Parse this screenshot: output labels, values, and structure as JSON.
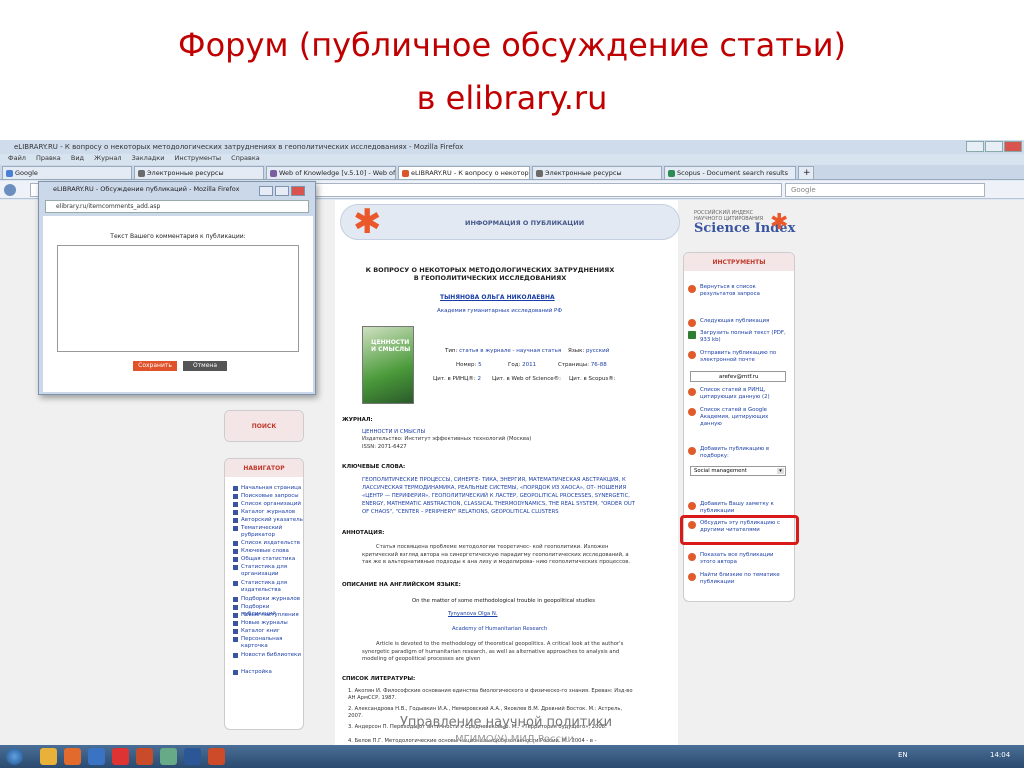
{
  "slide": {
    "title_line1": "Форум (публичное обсуждение статьи)",
    "title_line2": "в elibrary.ru",
    "footer_line1": "Управление научной политики",
    "footer_line2": "МГИМО(У) МИД России"
  },
  "browser": {
    "window_title": "eLIBRARY.RU - К вопросу о некоторых методологических затруднениях в геополитических исследованиях - Mozilla Firefox",
    "menu": [
      "Файл",
      "Правка",
      "Вид",
      "Журнал",
      "Закладки",
      "Инструменты",
      "Справка"
    ],
    "tabs": [
      {
        "label": "Google",
        "color": "#4a7fd6"
      },
      {
        "label": "Электронные ресурсы",
        "color": "#6a6a6a"
      },
      {
        "label": "Web of Knowledge [v.5.10] - Web of ...",
        "color": "#7a5fa0"
      },
      {
        "label": "eLIBRARY.RU - К вопросу о некотор...",
        "color": "#d9532b"
      },
      {
        "label": "Электронные ресурсы",
        "color": "#6a6a6a"
      },
      {
        "label": "Scopus - Document search results",
        "color": "#2e8b57"
      }
    ],
    "search_placeholder": "Google"
  },
  "popup": {
    "title": "eLIBRARY.RU - Обсуждение публикаций - Mozilla Firefox",
    "url": "elibrary.ru/itemcomments_add.asp",
    "label": "Текст Вашего комментария к публикации:",
    "save": "Сохранить",
    "cancel": "Отмена"
  },
  "article": {
    "header": "ИНФОРМАЦИЯ О ПУБЛИКАЦИИ",
    "title": "К ВОПРОСУ О НЕКОТОРЫХ МЕТОДОЛОГИЧЕСКИХ ЗАТРУДНЕНИЯХ В ГЕОПОЛИТИЧЕСКИХ ИССЛЕДОВАНИЯХ",
    "author": "ТЫНЯНОВА ОЛЬГА НИКОЛАЕВНА",
    "affiliation": "Академия гуманитарных исследований РФ",
    "cover_title": "ЦЕННОСТИ И СМЫСЛЫ",
    "type_label": "Тип:",
    "type_value": "статья в журнале - научная статья",
    "lang_label": "Язык:",
    "lang_value": "русский",
    "number_label": "Номер:",
    "number_value": "5",
    "year_label": "Год:",
    "year_value": "2011",
    "pages_label": "Страницы:",
    "pages_value": "76-88",
    "rinc_label": "Цит. в РИНЦ®:",
    "rinc_value": "2",
    "wos_label": "Цит. в Web of Science®:",
    "scopus_label": "Цит. в Scopus®:",
    "journal_section": "ЖУРНАЛ:",
    "journal_name": "ЦЕННОСТИ И СМЫСЛЫ",
    "publisher": "Издательство: Институт эффективных технологий (Москва)",
    "issn": "ISSN: 2071-6427",
    "keywords_section": "КЛЮЧЕВЫЕ СЛОВА:",
    "keywords": "ГЕОПОЛИТИЧЕСКИЕ ПРОЦЕССЫ, СИНЕРГЕ- ТИКА, ЭНЕРГИЯ, МАТЕМАТИЧЕСКАЯ АБСТРАКЦИЯ, К ЛАССИЧЕСКАЯ ТЕРМОДИНАМИКА, РЕАЛЬНЫЕ СИСТЕМЫ, «ПОРЯДОК ИЗ ХАОСА», ОТ- НОШЕНИЯ «ЦЕНТР — ПЕРИФЕРИЯ», ГЕОПОЛИТИЧЕСКИЙ К ЛАСТЕР, GEOPOLITICAL PROCESSES, SYNERGETIC, ENERGY, MATHEMATIC ABSTRACTION, CLASSICAL THERMODYNAMICS, THE REAL SYSTEM, \"ORDER OUT OF CHAOS\", \"CENTER – PERIPHERY\" RELATIONS, GEOPOLITICAL CLUSTERS",
    "annotation_section": "АННОТАЦИЯ:",
    "annotation": "Статья посвящена проблеме методологии теоретичес- кой геополитики. Изложен критический взгляд автора на синергетическую парадигму геополитических исследований, а так же в альтернативные подходы к ана лизу и моделирова- нию геополитических процессов.",
    "english_section": "ОПИСАНИЕ НА АНГЛИЙСКОМ ЯЗЫКЕ:",
    "english_title": "On the matter of some methodological trouble in geopolitical studies",
    "english_author": "Tynyanova Olga N.",
    "english_affiliation": "Academy of Humanitarian Research",
    "english_abstract": "Article is devoted to the methodology of theoretical geopolitics. A critical look at the author's synergetic paradigm of humanitarian research, as well as alternative approaches to analysis and modeling of geopolitical processes are given",
    "refs_section": "СПИСОК ЛИТЕРАТУРЫ:",
    "refs": [
      "1. Акопян И. Философские основания единства биологического и физическо-го знания. Ереван: Изд-во АН АрмССР, 1987.",
      "2. Александрова Н.В., Годывкин И.А., Немировский А.А., Яковлев В.М. Древний Восток. М.: Астрель, 2007.",
      "3. Андерсон П. Переходы от античности к Средневековью. М.: «Территория будущего», 2008.",
      "4. Белов П.Г. Методологические основы национальной безопасности России. М.: 2004 - в -"
    ]
  },
  "left": {
    "search_title": "ПОИСК",
    "nav_title": "НАВИГАТОР",
    "nav_items": [
      "Начальная страница",
      "Поисковые запросы",
      "Список организаций",
      "Каталог журналов",
      "Авторский указатель",
      "Тематический рубрикатор",
      "Список издательств",
      "Ключевые слова",
      "Общая статистика",
      "Статистика для организации",
      "Статистика для издательства",
      "Подборки журналов",
      "Подборки публикаций",
      "Новые поступления",
      "Новые журналы",
      "Каталог книг",
      "Персональная карточка",
      "Новости библиотеки",
      "Настройка"
    ]
  },
  "right": {
    "sci_line1": "РОССИЙСКИЙ ИНДЕКС",
    "sci_line2": "НАУЧНОГО ЦИТИРОВАНИЯ",
    "sci_brand": "Science Index",
    "tools_title": "ИНСТРУМЕНТЫ",
    "tools": [
      "Вернуться в список результатов запроса",
      "Следующая публикация",
      "Загрузить полный текст (PDF, 933 kb)",
      "Отправить публикацию по электронной почте",
      "Список статей в РИНЦ, цитирующих данную (2)",
      "Список статей в Google Академия, цитирующих данную",
      "Добавить публикацию в подборку:",
      "Добавить Вашу заметку к публикации",
      "Обсудить эту публикацию с другими читателями",
      "Показать все публикации этого автора",
      "Найти близкие по тематике публикации"
    ],
    "email_value": "arefev@mtf.ru",
    "select_value": "Social management"
  },
  "taskbar": {
    "lang": "EN",
    "time": "14:04"
  }
}
